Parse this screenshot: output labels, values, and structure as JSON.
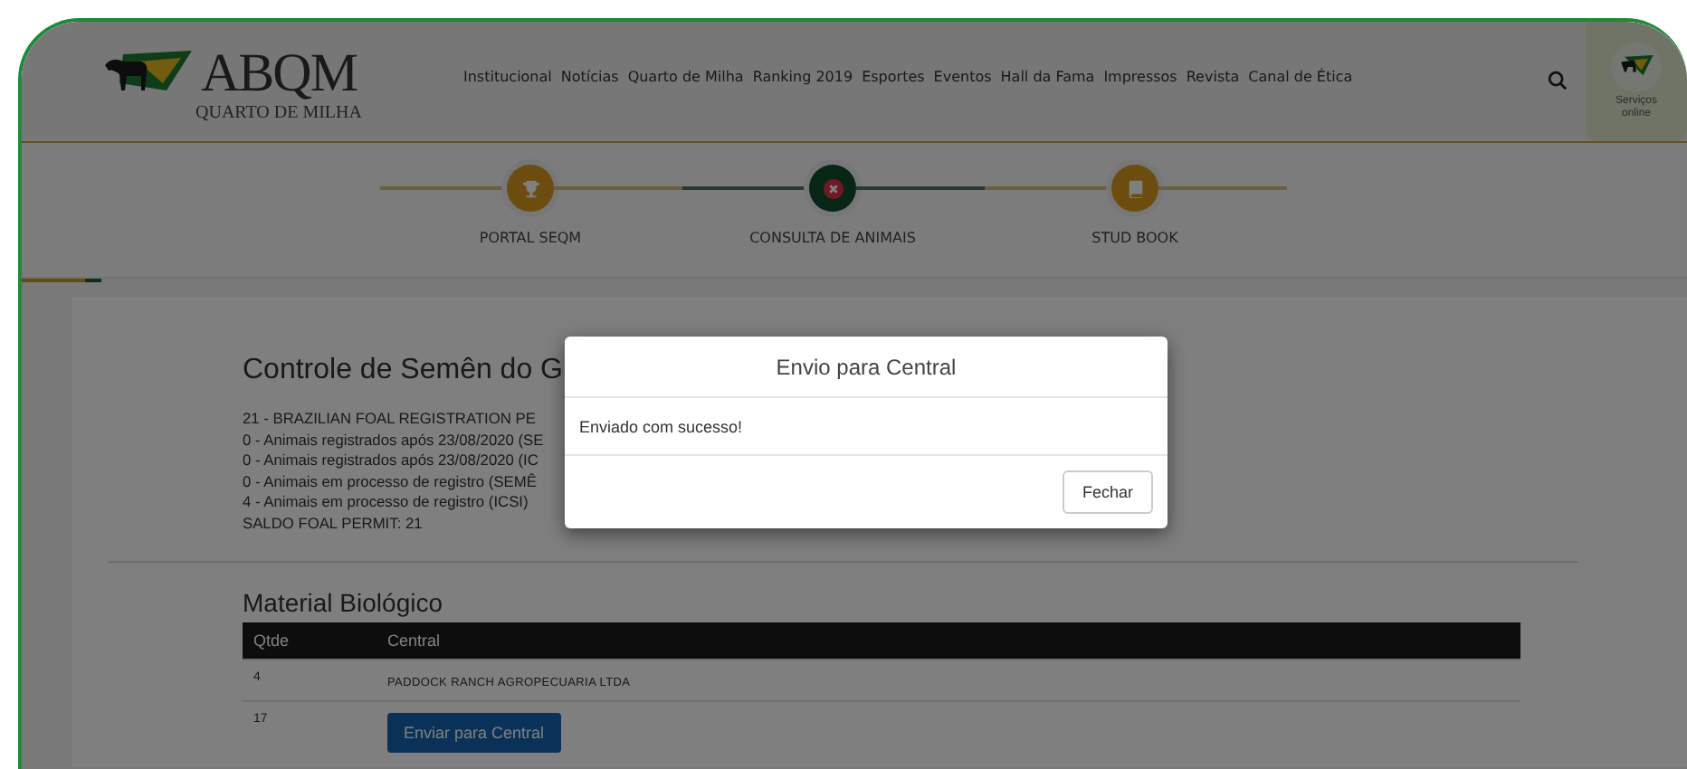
{
  "header": {
    "logo": {
      "name": "ABQM",
      "subtitle": "QUARTO DE MILHA"
    },
    "nav": [
      "Institucional",
      "Notícias",
      "Quarto de Milha",
      "Ranking 2019",
      "Esportes",
      "Eventos",
      "Hall da Fama",
      "Impressos",
      "Revista",
      "Canal de Ética"
    ],
    "services": {
      "label": "Serviços online"
    }
  },
  "steps": [
    {
      "label": "PORTAL SEQM",
      "kind": "trophy",
      "selected": false
    },
    {
      "label": "CONSULTA DE ANIMAIS",
      "kind": "close",
      "selected": true
    },
    {
      "label": "STUD BOOK",
      "kind": "book",
      "selected": false
    }
  ],
  "content": {
    "title": "Controle de Semên do G",
    "lines": [
      "21 - BRAZILIAN FOAL REGISTRATION PE",
      "0 - Animais registrados após 23/08/2020 (SE",
      "0 - Animais registrados após 23/08/2020 (IC",
      "0 - Animais em processo de registro (SEMÊ",
      "4 - Animais em processo de registro (ICSI)",
      "SALDO FOAL PERMIT: 21"
    ],
    "section_title": "Material Biológico",
    "table": {
      "columns": [
        "Qtde",
        "Central"
      ],
      "rows": [
        {
          "qtde": "4",
          "kind": "text",
          "central": "PADDOCK RANCH AGROPECUARIA LTDA"
        },
        {
          "qtde": "17",
          "kind": "button",
          "central": "Enviar para Central"
        }
      ]
    }
  },
  "modal": {
    "title": "Envio para Central",
    "message": "Enviado com sucesso!",
    "button": "Fechar"
  }
}
